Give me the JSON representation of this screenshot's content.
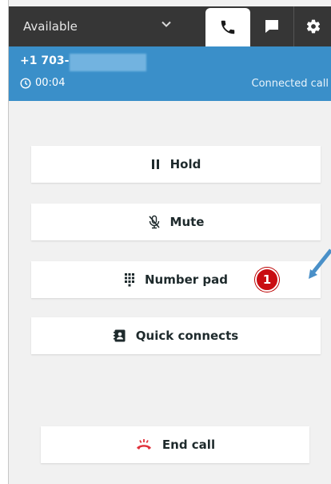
{
  "topbar": {
    "status_label": "Available",
    "tabs": [
      {
        "name": "phone",
        "icon": "phone-icon",
        "active": true
      },
      {
        "name": "chat",
        "icon": "chat-icon",
        "active": false
      },
      {
        "name": "settings",
        "icon": "gear-icon",
        "active": false
      }
    ]
  },
  "call": {
    "number_prefix": "+1 703-",
    "number_redacted": true,
    "timer": "00:04",
    "state": "Connected call"
  },
  "actions": {
    "hold_label": "Hold",
    "mute_label": "Mute",
    "number_pad_label": "Number pad",
    "quick_connects_label": "Quick connects",
    "end_call_label": "End call"
  },
  "annotation": {
    "badge_number": "1"
  },
  "colors": {
    "topbar_bg": "#363636",
    "call_bar_bg": "#3a8fc9",
    "panel_bg": "#f1f1f1",
    "end_call_icon": "#e0303a",
    "badge_red": "#c90d12",
    "arrow_blue": "#4a90c8"
  }
}
